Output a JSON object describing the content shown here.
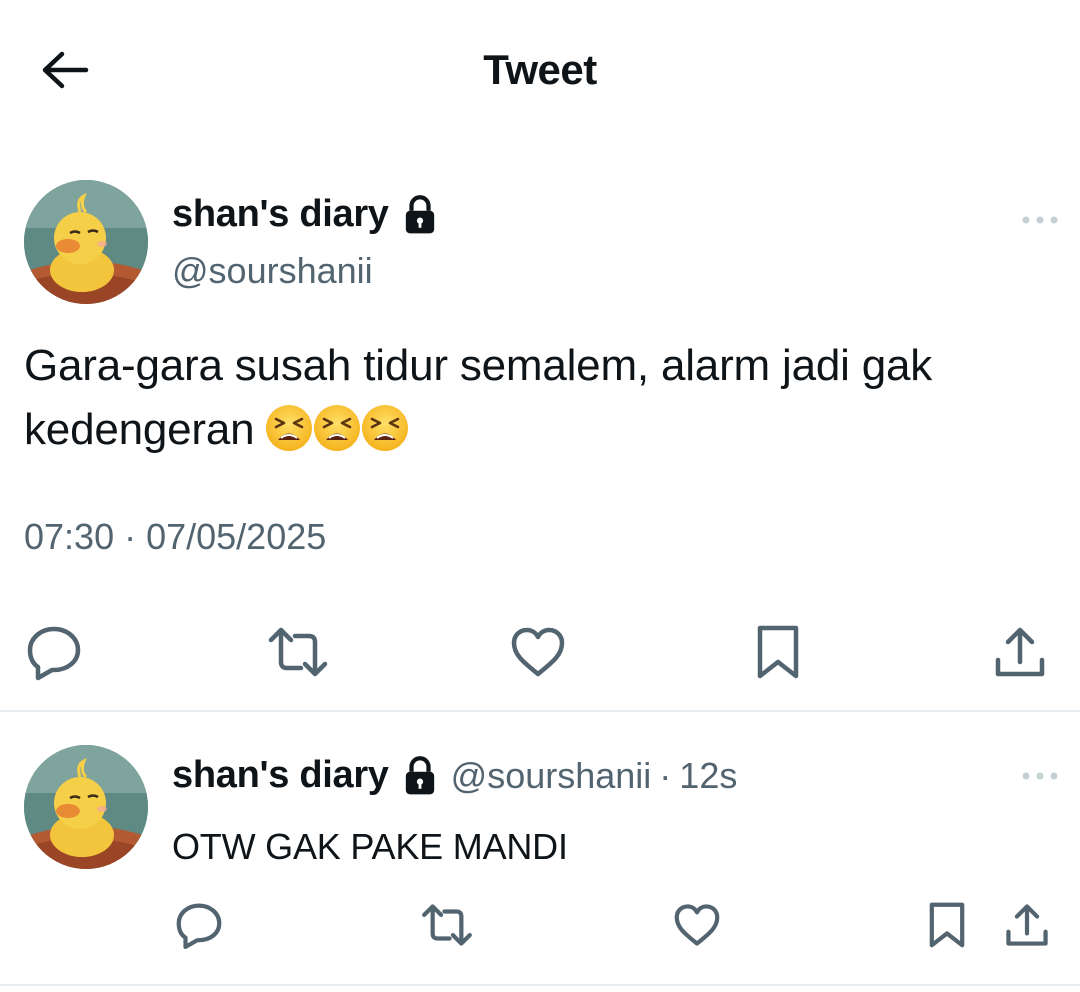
{
  "header": {
    "title": "Tweet",
    "back_icon": "arrow-left-icon"
  },
  "main_tweet": {
    "display_name": "shan's diary",
    "handle": "@sourshanii",
    "text": "Gara-gara susah tidur semalem, alarm jadi gak kedengeran",
    "emojis": [
      "tired-face-emoji",
      "tired-face-emoji",
      "tired-face-emoji"
    ],
    "timestamp": "07:30 · 07/05/2025",
    "protected": true,
    "avatar": "yellow duckling avatar",
    "actions": [
      "reply-icon",
      "retweet-icon",
      "like-icon",
      "bookmark-icon",
      "share-icon"
    ]
  },
  "reply_tweet": {
    "display_name": "shan's diary",
    "handle": "@sourshanii",
    "separator": "·",
    "time": "12s",
    "text": "OTW GAK PAKE MANDI",
    "protected": true,
    "actions": [
      "reply-icon",
      "retweet-icon",
      "like-icon",
      "bookmark-icon",
      "share-icon"
    ]
  },
  "colors": {
    "text_primary": "#0f1419",
    "text_secondary": "#536471",
    "divider": "#e6ecf0",
    "icon": "#536471"
  }
}
